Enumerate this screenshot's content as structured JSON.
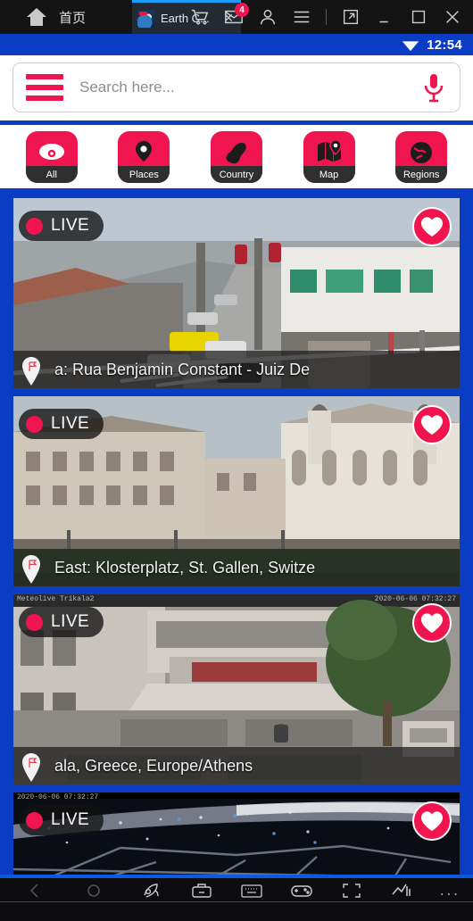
{
  "titlebar": {
    "home_label": "首页",
    "home_icon": "home-icon",
    "tab": {
      "title": "Earth C...",
      "favicon": "earth-camera-favicon",
      "close": "✕"
    },
    "icons": [
      {
        "name": "cart-icon"
      },
      {
        "name": "mail-icon",
        "badge": "4"
      },
      {
        "name": "account-icon"
      },
      {
        "name": "menu-icon"
      }
    ],
    "window_controls": [
      {
        "name": "restore-window-icon"
      },
      {
        "name": "minimize-window-icon"
      },
      {
        "name": "maximize-window-icon"
      },
      {
        "name": "close-window-icon"
      }
    ]
  },
  "statusbar": {
    "wifi_icon": "wifi-icon",
    "clock": "12:54"
  },
  "search": {
    "placeholder": "Search here...",
    "value": "",
    "menu_icon": "hamburger-icon",
    "mic_icon": "microphone-icon"
  },
  "categories": [
    {
      "label": "All",
      "icon": "cctv-camera-icon"
    },
    {
      "label": "Places",
      "icon": "location-pin-icon"
    },
    {
      "label": "Country",
      "icon": "country-shape-icon"
    },
    {
      "label": "Map",
      "icon": "map-pin-icon"
    },
    {
      "label": "Regions",
      "icon": "globe-icon"
    }
  ],
  "colors": {
    "brand_blue": "#0a3cc4",
    "accent_pink": "#f0154f",
    "titlebar_dark": "#141414",
    "tab_active": "#1a9fff"
  },
  "cameras": [
    {
      "live_label": "LIVE",
      "caption": "a: Rua Benjamin Constant - Juiz De",
      "overlay_left": "",
      "overlay_right": "",
      "scene": "daytime-street-brazil"
    },
    {
      "live_label": "LIVE",
      "caption": "East: Klosterplatz, St. Gallen, Switze",
      "overlay_left": "",
      "overlay_right": "",
      "scene": "abbey-square-switzerland"
    },
    {
      "live_label": "LIVE",
      "caption": "ala, Greece, Europe/Athens",
      "overlay_left": "Meteolive Trikala2",
      "overlay_right": "2020-06-06 07:32:27",
      "scene": "town-square-greece"
    },
    {
      "live_label": "LIVE",
      "caption": "",
      "overlay_left": "2020-06-06 07:32:27",
      "overlay_right": "",
      "scene": "night-city-lights"
    }
  ],
  "bottombar": {
    "left_icons": [
      {
        "name": "back-icon"
      },
      {
        "name": "home-circle-icon"
      }
    ],
    "right_icons": [
      {
        "name": "rocket-icon"
      },
      {
        "name": "toolbox-icon"
      },
      {
        "name": "keyboard-icon"
      },
      {
        "name": "gamepad-icon"
      },
      {
        "name": "fullscreen-icon"
      },
      {
        "name": "volume-icon"
      }
    ],
    "more_label": "..."
  }
}
